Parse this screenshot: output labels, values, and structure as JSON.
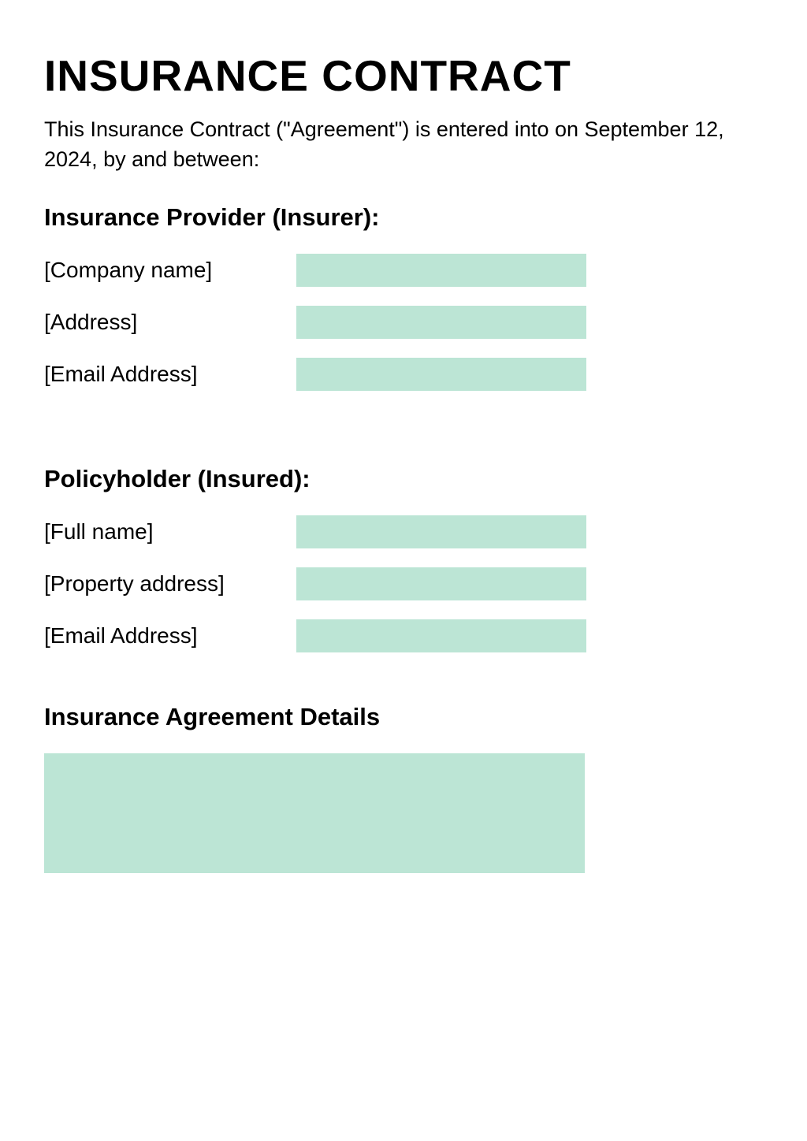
{
  "title": "INSURANCE CONTRACT",
  "intro": "This Insurance Contract (\"Agreement\") is entered into on September 12, 2024, by and between:",
  "insurer": {
    "heading": "Insurance Provider (Insurer):",
    "fields": {
      "company": "[Company name]",
      "address": "[Address]",
      "email": "[Email Address]"
    }
  },
  "insured": {
    "heading": "Policyholder (Insured):",
    "fields": {
      "fullname": "[Full name]",
      "property": "[Property address]",
      "email": "[Email Address]"
    }
  },
  "details": {
    "heading": "Insurance Agreement Details"
  }
}
